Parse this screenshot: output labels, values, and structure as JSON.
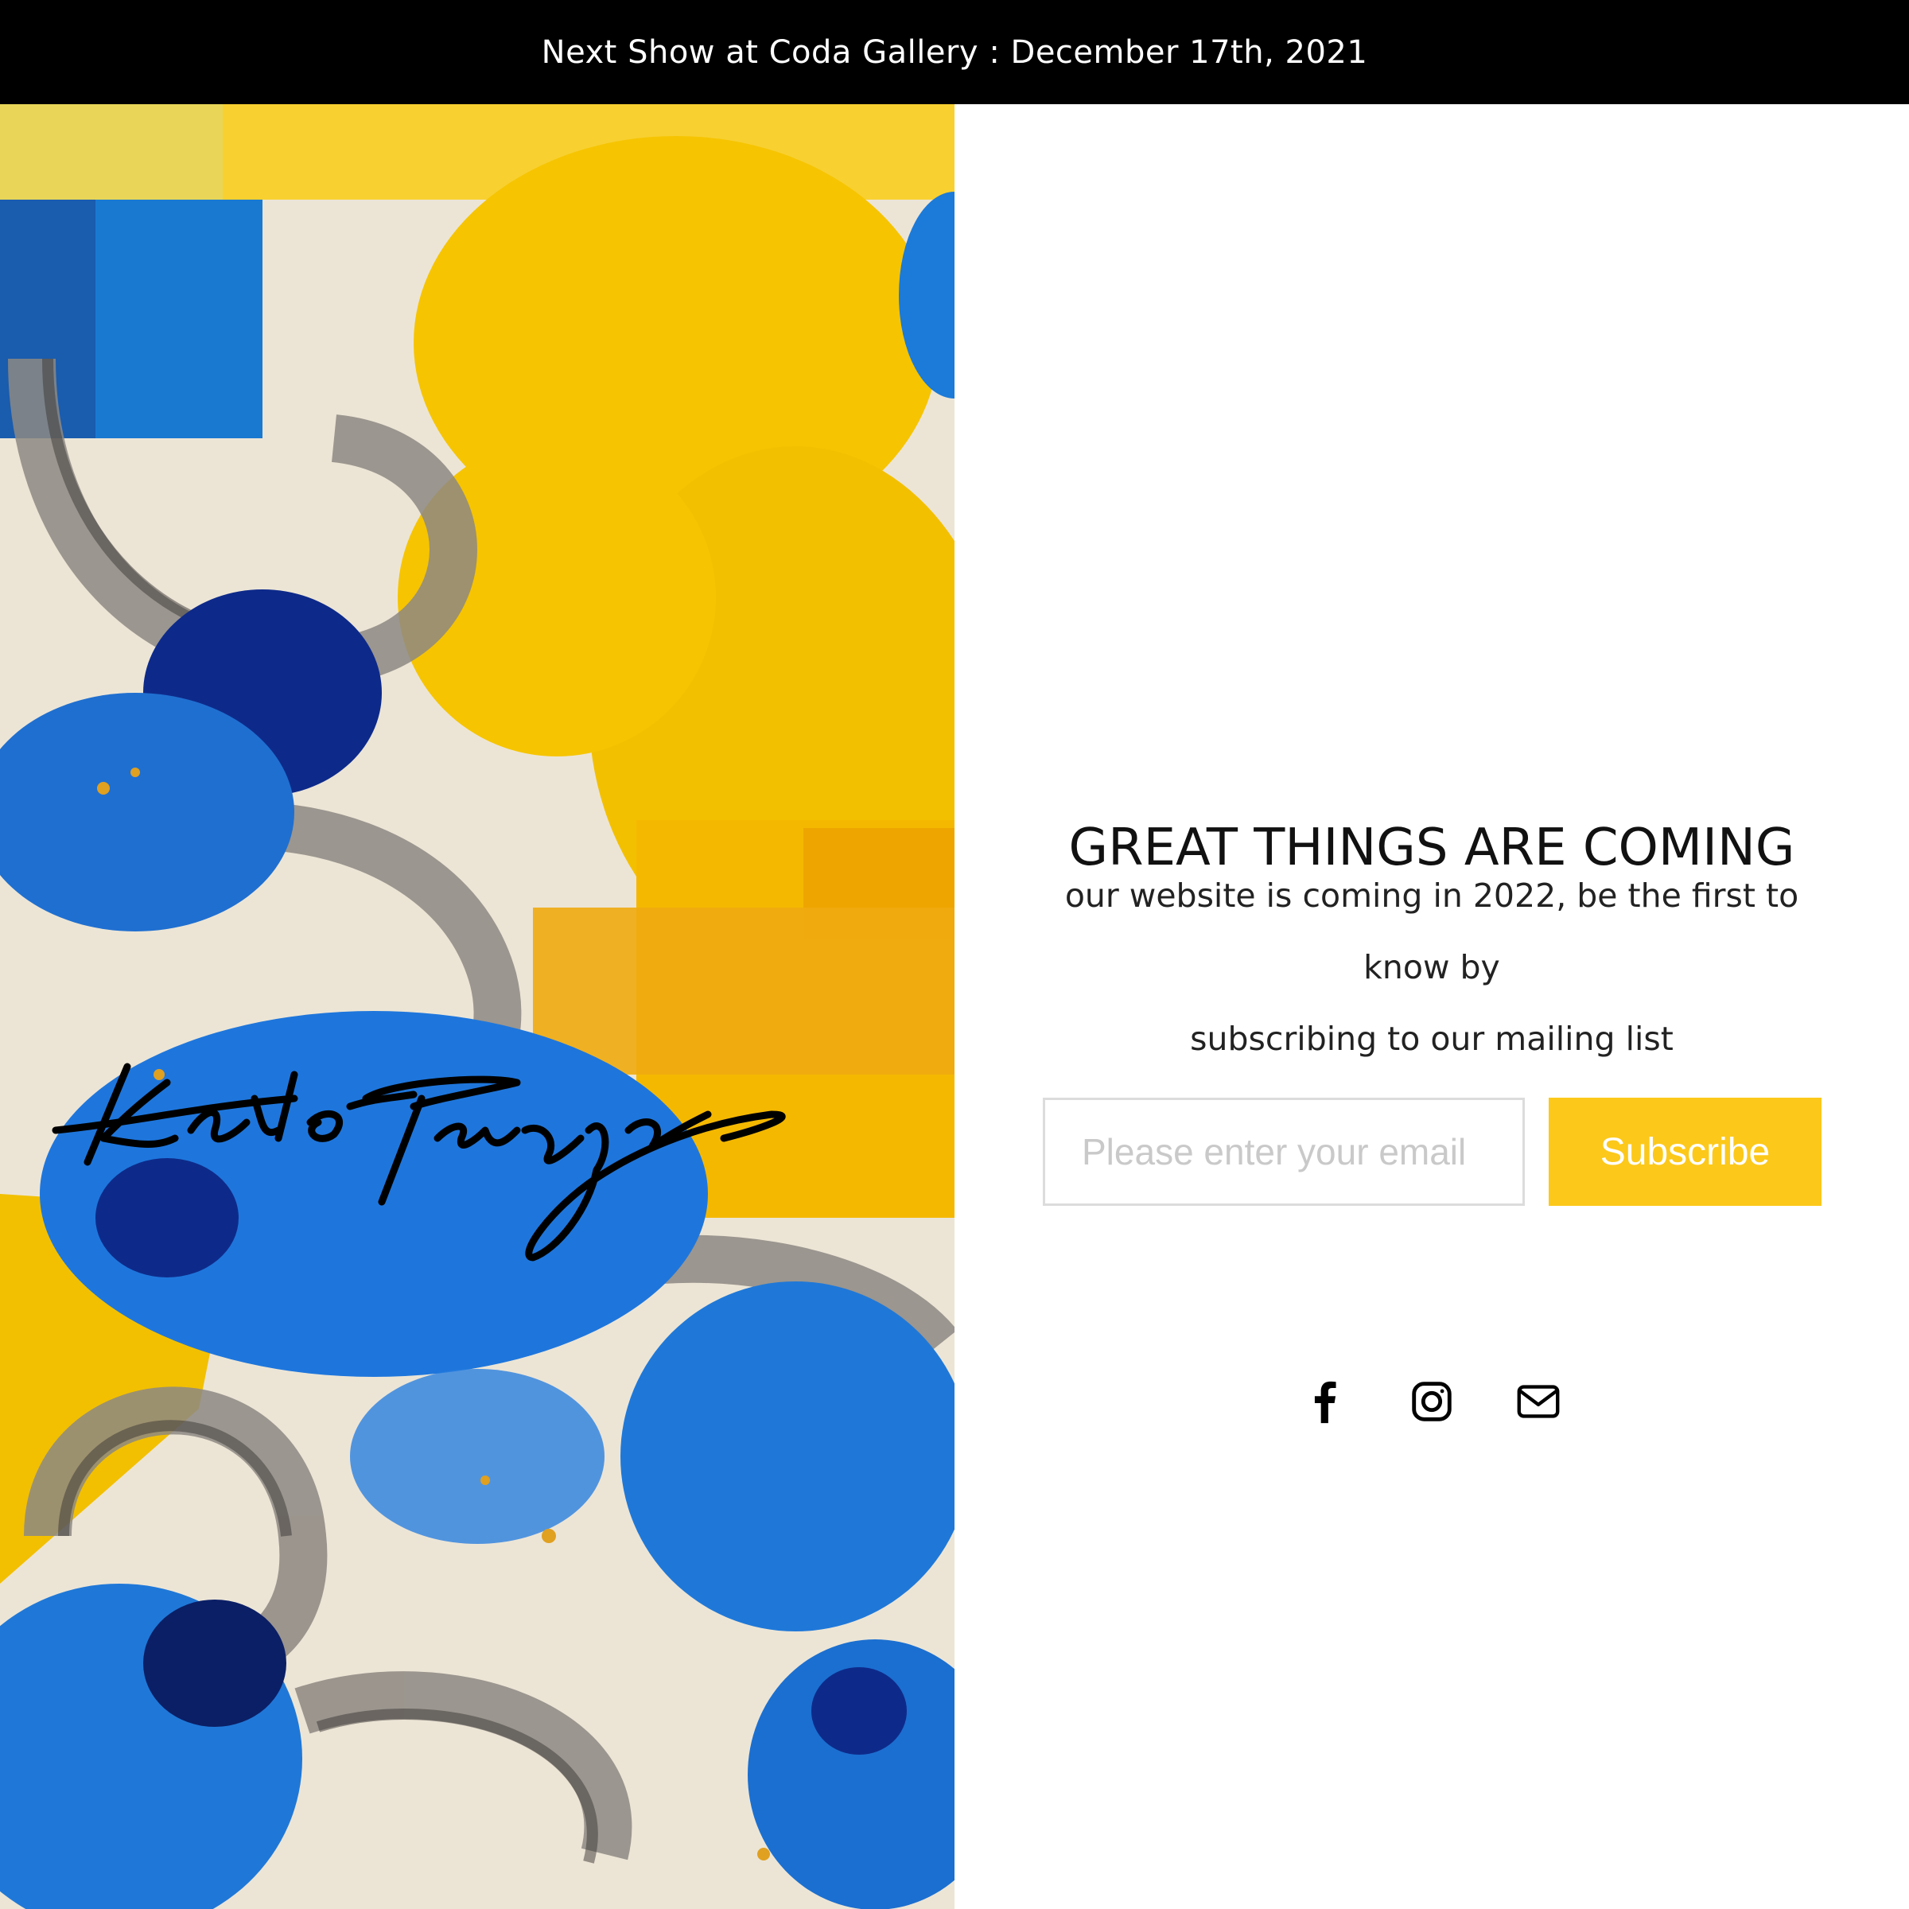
{
  "announcement": {
    "text": "Next Show at Coda Gallery : December 17th, 2021"
  },
  "artwork": {
    "signature_text": "Karlos Marquez",
    "colors": {
      "yellow": "#f5c300",
      "blue": "#1f78d8",
      "navy": "#0d2a8a",
      "grey": "#8b8580",
      "canvas": "#ece5d6"
    }
  },
  "main": {
    "headline": "GREAT THINGS ARE COMING",
    "subtext_line1": "our website is coming in 2022, be the first to know by",
    "subtext_line2": "subscribing to our mailing list"
  },
  "form": {
    "email_placeholder": "Please enter your email",
    "email_value": "",
    "subscribe_label": "Subscribe",
    "accent_color": "#fcc81a"
  },
  "social": {
    "icons": [
      "facebook-icon",
      "instagram-icon",
      "email-icon"
    ]
  }
}
